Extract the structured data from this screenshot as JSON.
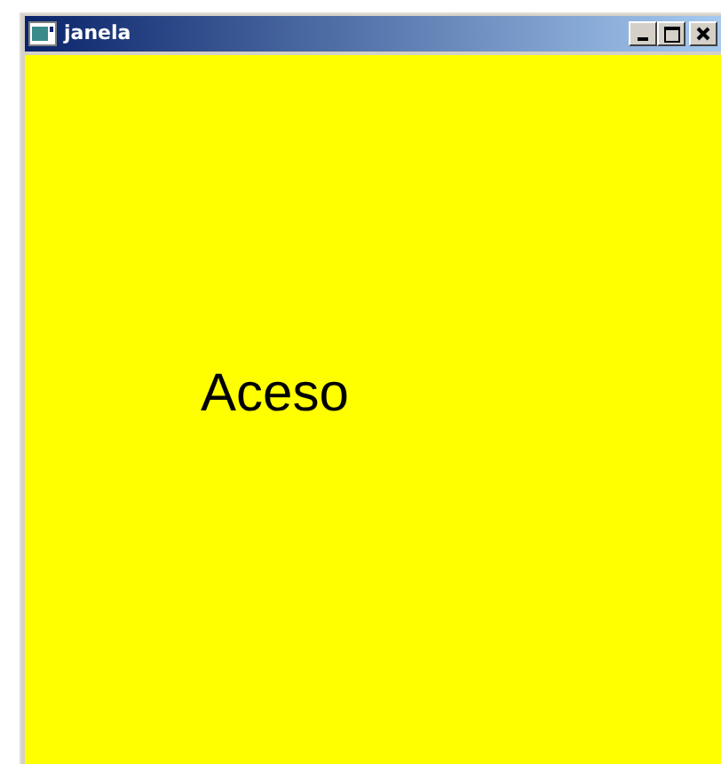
{
  "window": {
    "title": "janela"
  },
  "content": {
    "label": "Aceso",
    "on": true
  }
}
